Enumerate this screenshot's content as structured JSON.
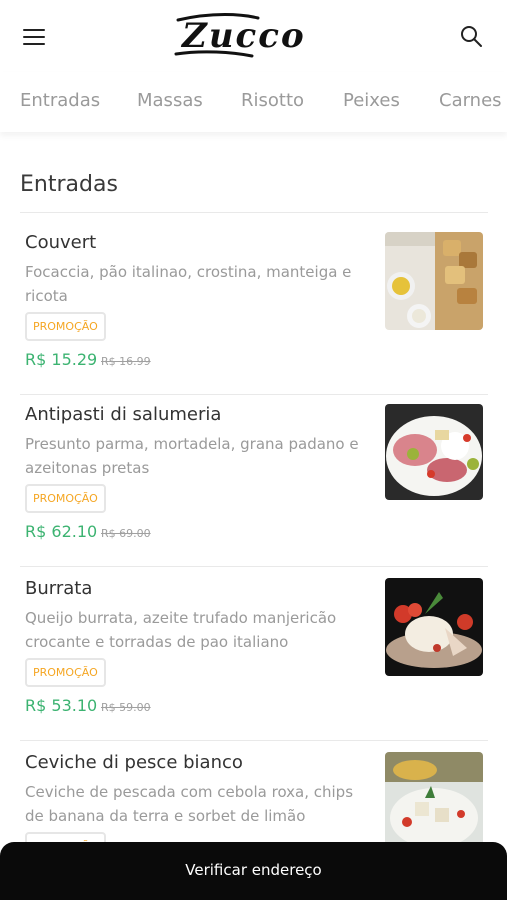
{
  "header": {
    "logo_text": "Zucco",
    "menu_icon": "hamburger-icon",
    "search_icon": "search-icon"
  },
  "tabs": [
    "Entradas",
    "Massas",
    "Risotto",
    "Peixes",
    "Carnes"
  ],
  "section": {
    "title": "Entradas"
  },
  "items": [
    {
      "name": "Couvert",
      "description": "Focaccia, pão italinao, crostina, manteiga e ricota",
      "badge": "PROMOÇÃO",
      "price": "R$ 15.29",
      "old_price": "R$ 16.99"
    },
    {
      "name": "Antipasti di salumeria",
      "description": "Presunto parma, mortadela, grana padano e azeitonas pretas",
      "badge": "PROMOÇÃO",
      "price": "R$ 62.10",
      "old_price": "R$ 69.00"
    },
    {
      "name": "Burrata",
      "description": "Queijo burrata, azeite trufado manjericão crocante e torradas de pao italiano",
      "badge": "PROMOÇÃO",
      "price": "R$ 53.10",
      "old_price": "R$ 59.00"
    },
    {
      "name": "Ceviche di pesce bianco",
      "description": "Ceviche de pescada com cebola roxa, chips de banana da terra e sorbet de limão sicillano",
      "badge": "PROMOÇÃO",
      "price": "",
      "old_price": ""
    }
  ],
  "bottom_bar": {
    "label": "Verificar endereço"
  },
  "colors": {
    "price": "#3cb371",
    "badge": "#f5a623",
    "bottom_bar": "#0a0a0a"
  }
}
